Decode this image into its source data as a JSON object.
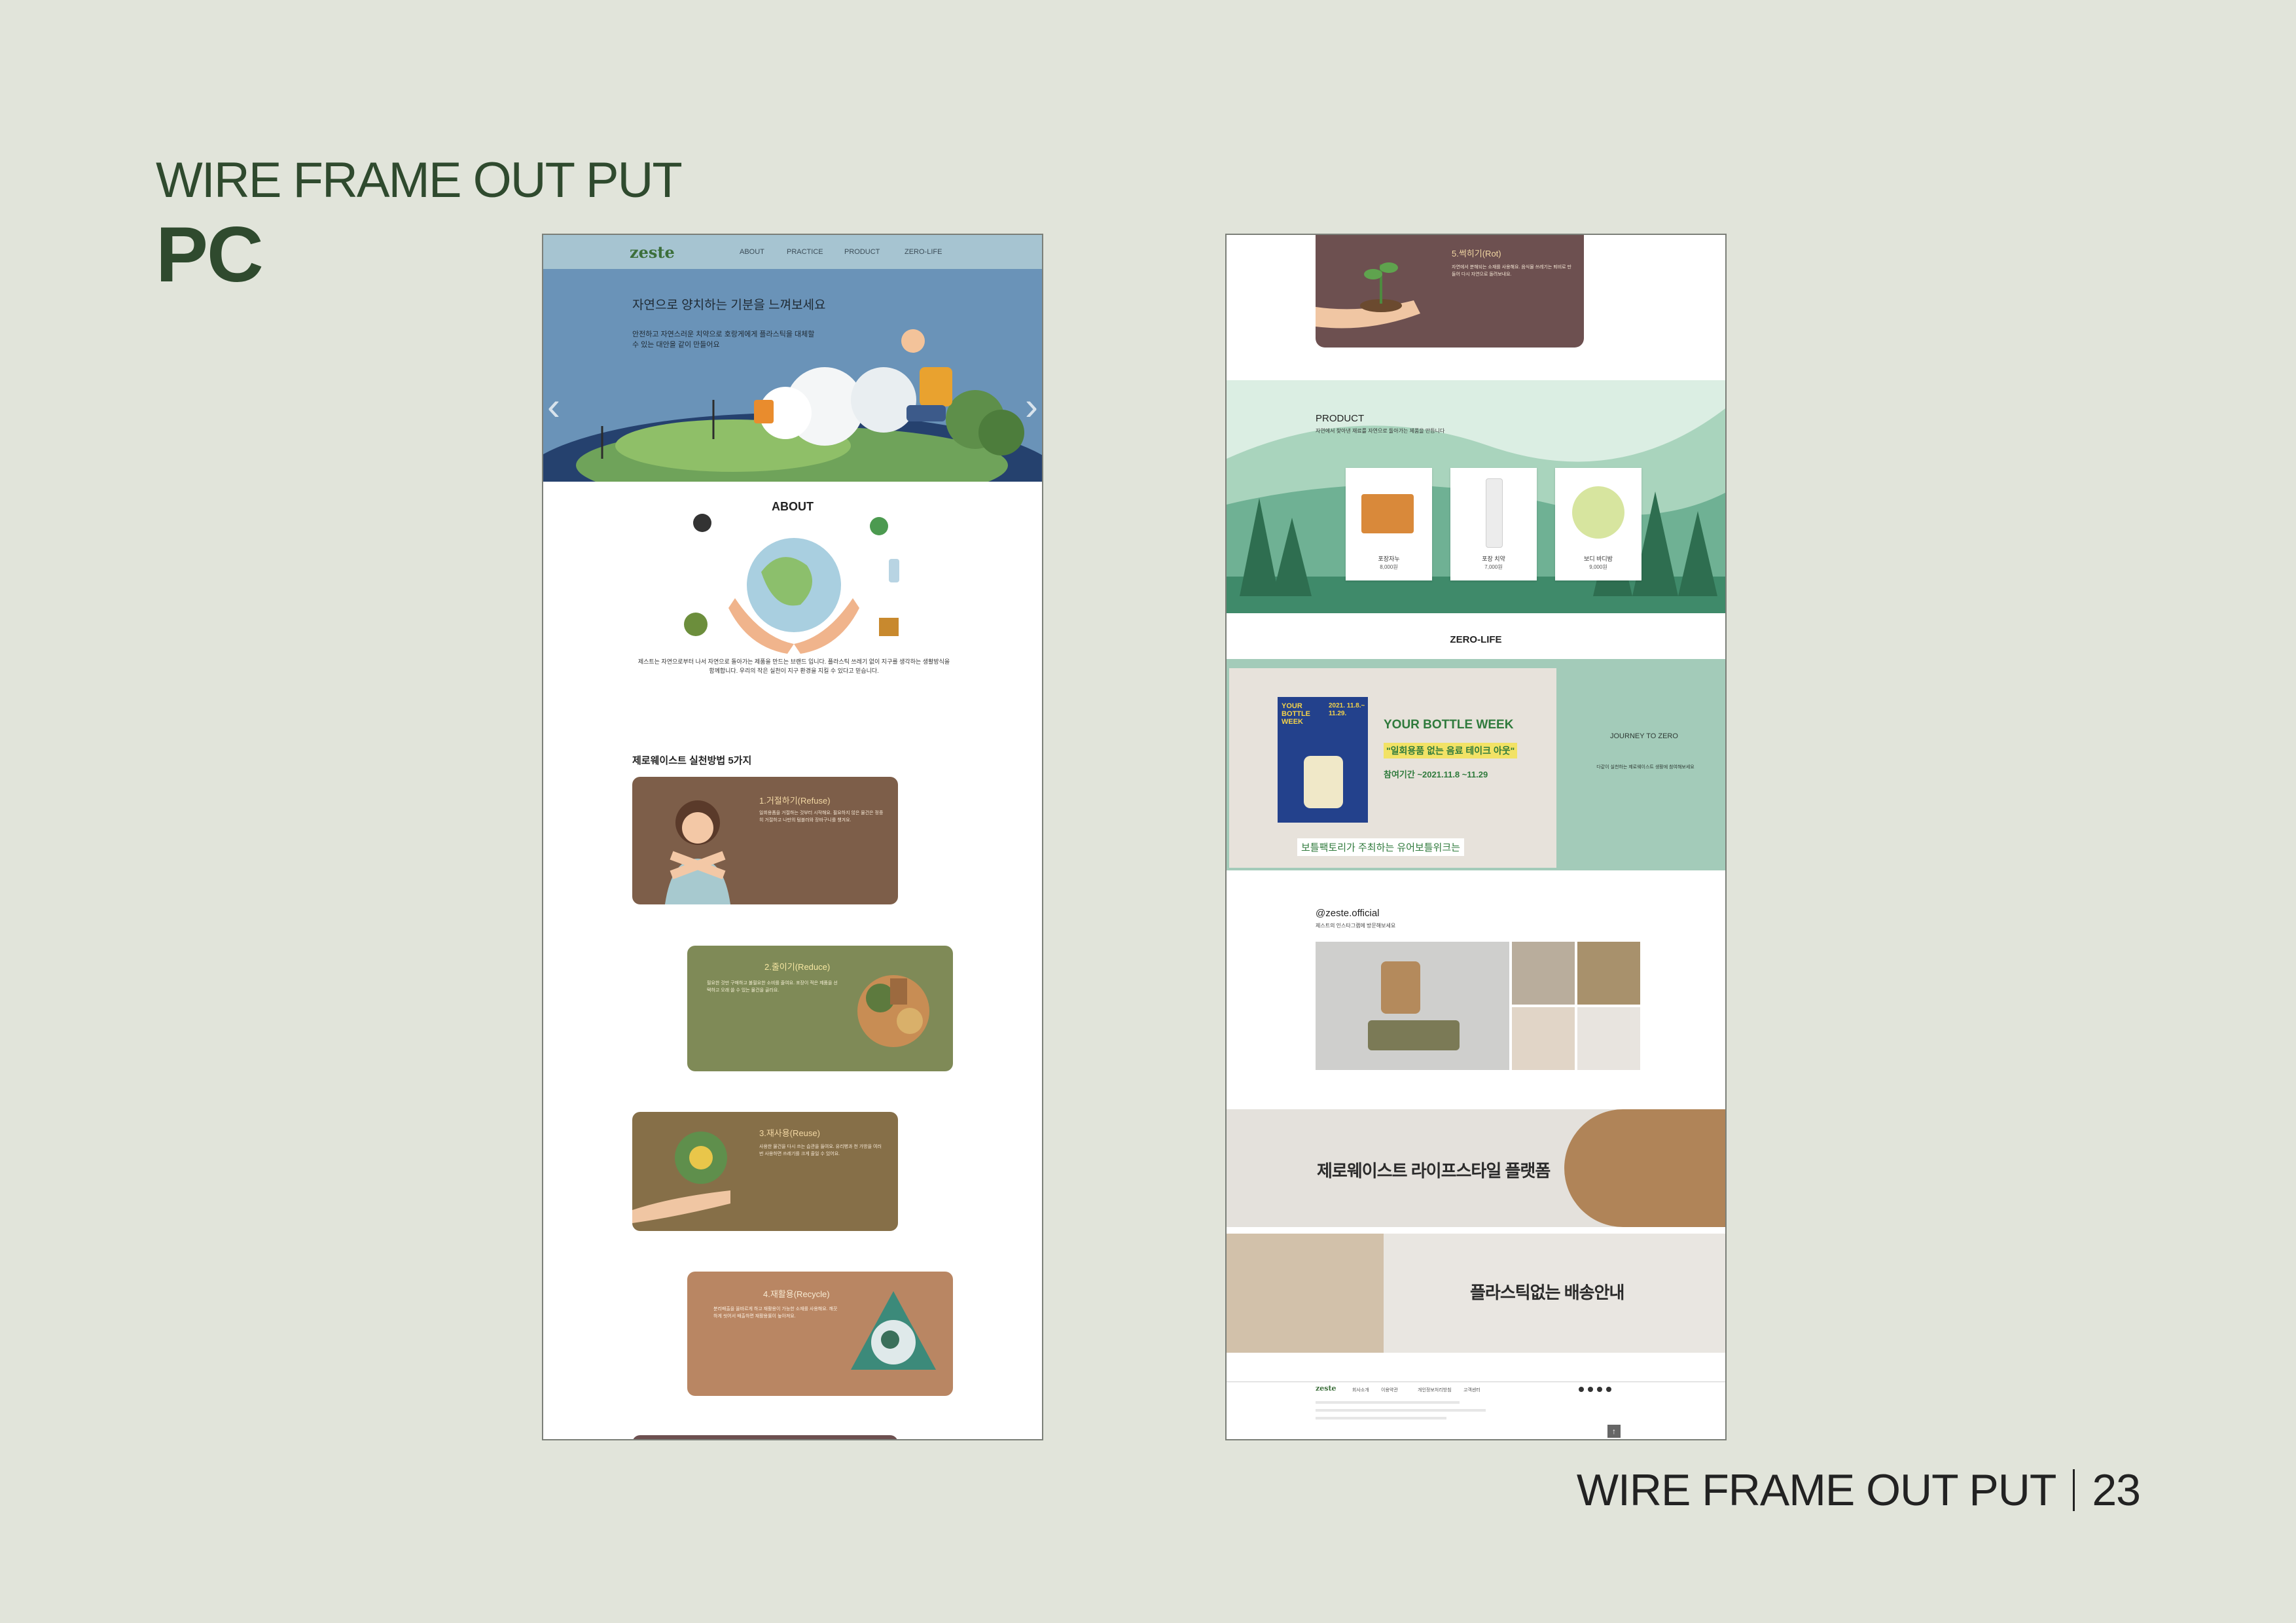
{
  "heading": "WIRE FRAME OUT PUT",
  "subheading": "PC",
  "footer": {
    "label": "WIRE FRAME OUT PUT",
    "page_number": "23"
  },
  "left_page": {
    "logo": "zeste",
    "nav": [
      "ABOUT",
      "PRACTICE",
      "PRODUCT",
      "ZERO-LIFE"
    ],
    "hero": {
      "title": "자연으로 양치하는 기분을 느껴보세요",
      "subtitle": "안전하고 자연스러운 치약으로 호랑게에게 플라스틱을 대체할 수 있는 대안을 같이 만들어요"
    },
    "about": {
      "title": "ABOUT",
      "text": "제스트는 자연으로부터 나서 자연으로 돌아가는 제품을 만드는 브랜드 입니다. 플라스틱 쓰레기 없이 지구를 생각하는 생활방식을 함께합니다. 우리의 작은 실천이 지구 환경을 지킬 수 있다고 믿습니다."
    },
    "practice": {
      "title": "제로웨이스트 실천방법 5가지",
      "cards": [
        {
          "title": "1.거절하기(Refuse)",
          "text": "일회용품을 거절하는 것부터 시작해요. 필요하지 않은 물건은 정중히 거절하고 나만의 텀블러와 장바구니를 챙겨요."
        },
        {
          "title": "2.줄이기(Reduce)",
          "text": "필요한 것만 구매하고 불필요한 소비를 줄여요. 포장이 적은 제품을 선택하고 오래 쓸 수 있는 물건을 골라요."
        },
        {
          "title": "3.재사용(Reuse)",
          "text": "사용한 물건을 다시 쓰는 습관을 들여요. 유리병과 천 가방을 여러 번 사용하면 쓰레기를 크게 줄일 수 있어요."
        },
        {
          "title": "4.재활용(Recycle)",
          "text": "분리배출을 올바르게 하고 재활용이 가능한 소재를 사용해요. 깨끗하게 씻어서 배출하면 재활용률이 높아져요."
        }
      ]
    }
  },
  "right_page": {
    "fact_card": {
      "title": "5.썩히기(Rot)",
      "text": "자연에서 분해되는 소재를 사용해요. 음식물 쓰레기는 퇴비로 만들어 다시 자연으로 돌려보내요."
    },
    "product": {
      "title": "PRODUCT",
      "subtitle": "자연에서 찾아낸 재료를 자연으로 돌아가는 제품을 만듭니다",
      "items": [
        {
          "name": "포장자누",
          "price": "8,000원"
        },
        {
          "name": "포장 치약",
          "price": "7,000원"
        },
        {
          "name": "보디 바디밤",
          "price": "9,000원"
        }
      ]
    },
    "zero_life": {
      "title": "ZERO-LIFE",
      "poster": {
        "tag": "YOUR BOTTLE WEEK",
        "year": "2021. 11.8.~ 11.29.",
        "title": "YOUR BOTTLE WEEK",
        "slogan": "\"일회용품 없는 음료 테이크 아웃\"",
        "period": "참여기간 ~2021.11.8 ~11.29",
        "caption": "보틀팩토리가 주최하는 유어보틀위크는"
      },
      "side": {
        "title": "JOURNEY TO ZERO",
        "text": "다같이 실천하는 제로웨이스트 생활에 참여해보세요"
      }
    },
    "instagram": {
      "handle": "@zeste.official",
      "sub": "제스트의 인스타그램에 방문해보세요"
    },
    "banners": [
      "제로웨이스트 라이프스타일 플랫폼",
      "플라스틱없는 배송안내"
    ],
    "footer": {
      "logo": "zeste",
      "nav": [
        "회사소개",
        "이용약관",
        "개인정보처리방침",
        "고객센터"
      ]
    }
  },
  "colors": {
    "bg": "#e1e4da",
    "heading": "#2f4a2e",
    "card_brown": "#7d5e49",
    "card_olive": "#7f8a57",
    "card_khaki": "#866f48",
    "card_terracotta": "#b98663",
    "card_mauve": "#6d5050",
    "product_green": "#8fc4a9",
    "zero_side": "#a3cbb9"
  }
}
